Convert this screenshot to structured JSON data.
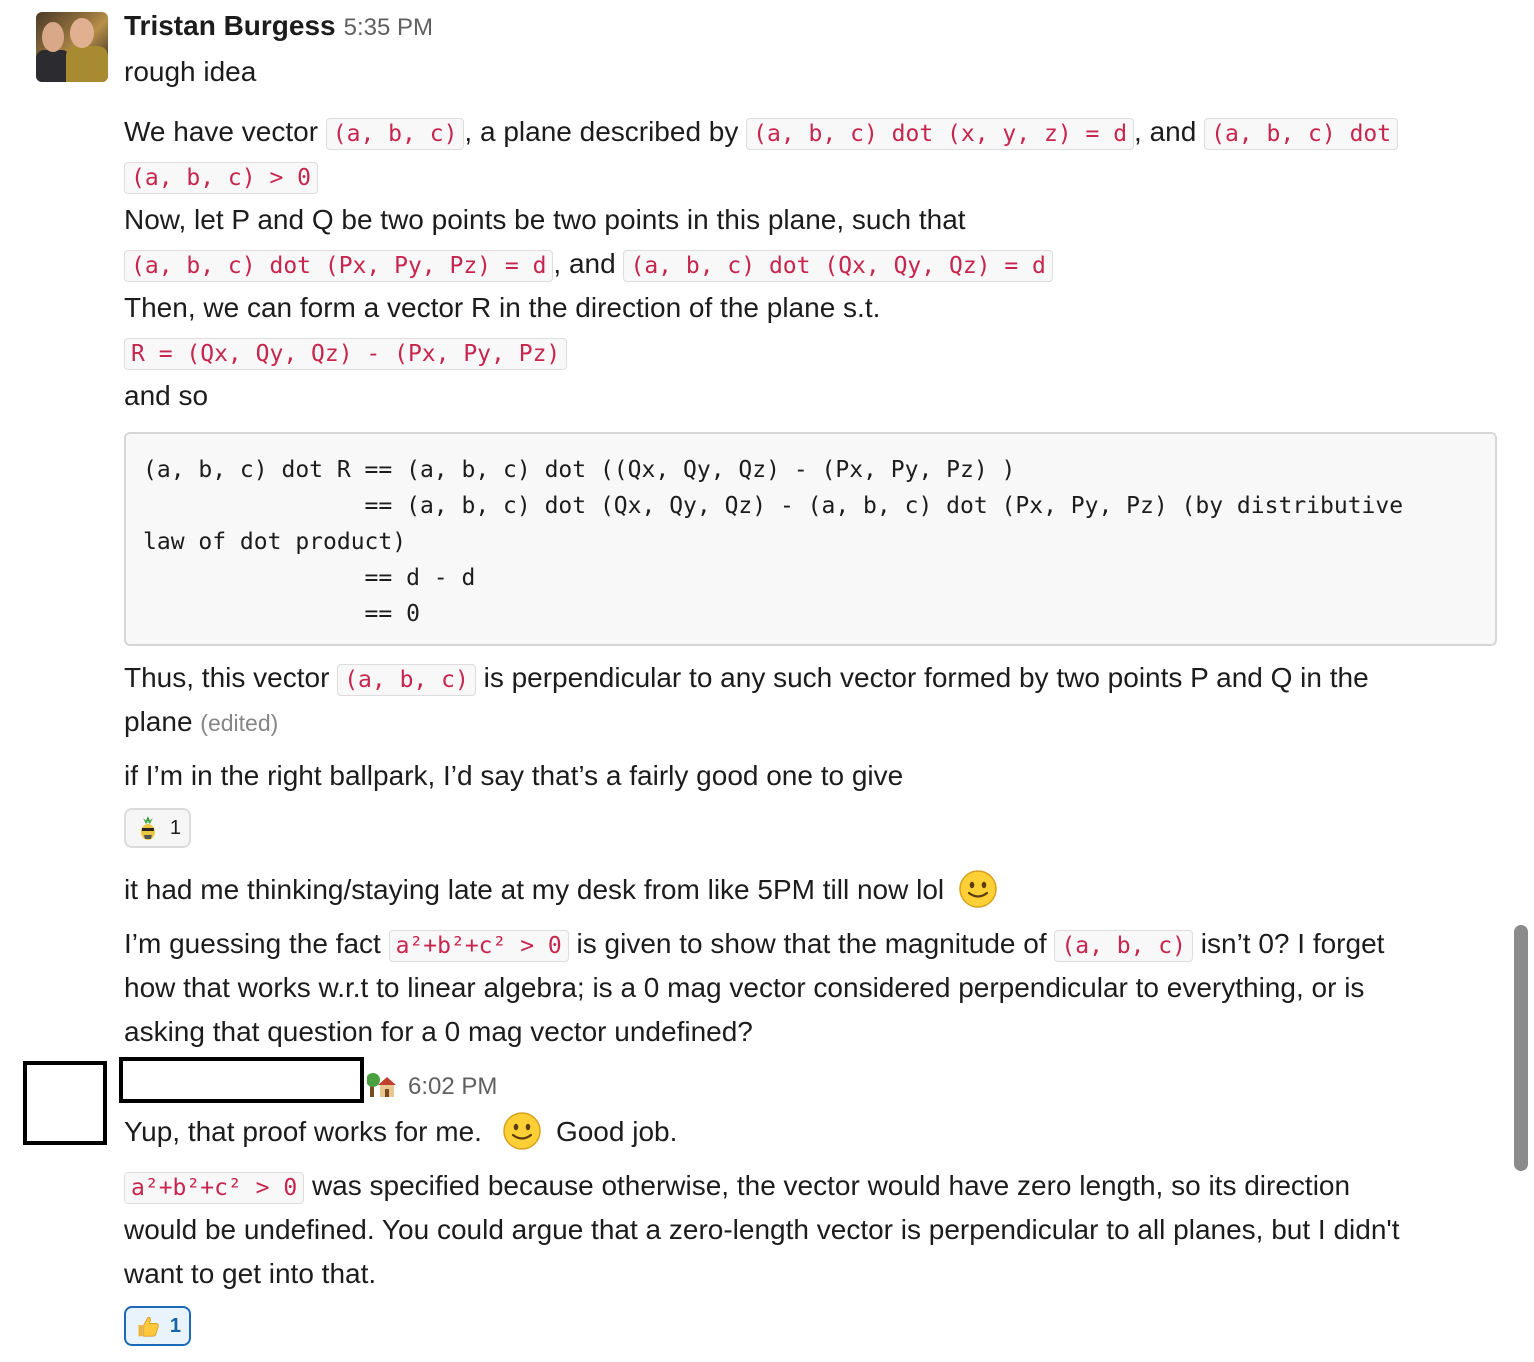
{
  "message1": {
    "author": "Tristan Burgess",
    "time": "5:35 PM",
    "line1": "rough idea",
    "p1": {
      "t1": "We have vector ",
      "c1": "(a, b, c)",
      "t2": ", a plane described by ",
      "c2": "(a, b, c) dot (x, y, z) = d",
      "t3": ", and ",
      "c3a": "(a, b, c) dot",
      "c3b": "(a, b, c) > 0"
    },
    "p2": "Now, let P and Q be two points be two points in this plane, such that",
    "p3": {
      "c1": "(a, b, c) dot (Px, Py, Pz) = d",
      "t1": ", and ",
      "c2": "(a, b, c) dot (Qx, Qy, Qz) = d"
    },
    "p4": "Then, we can form a vector R in the direction of the plane s.t.",
    "p5": "R = (Qx, Qy, Qz) - (Px, Py, Pz)",
    "p6": "and so",
    "code_block": "(a, b, c) dot R == (a, b, c) dot ((Qx, Qy, Qz) - (Px, Py, Pz) )\n                == (a, b, c) dot (Qx, Qy, Qz) - (a, b, c) dot (Px, Py, Pz) (by distributive\nlaw of dot product)\n                == d - d\n                == 0",
    "p7": {
      "t1": "Thus, this vector ",
      "c1": "(a, b, c)",
      "t2": " is perpendicular to any such vector formed by two points P and Q in the",
      "t3": "plane ",
      "edited": "(edited)"
    },
    "p8": "if I’m in the right ballpark, I’d say that’s a fairly good one to give",
    "reaction": {
      "icon": "pineapple-emoji-icon",
      "count": "1"
    },
    "p9": "it had me thinking/staying late at my desk from like 5PM till now lol",
    "p10": {
      "t1": "I’m guessing the fact ",
      "c1": "a²+b²+c² > 0",
      "t2": " is given to show that the magnitude of ",
      "c2": "(a, b, c)",
      "t3": " isn’t 0? I forget",
      "t4": "how that works w.r.t to linear algebra; is a 0 mag vector considered perpendicular to everything, or is",
      "t5": "asking that question for a 0 mag vector undefined?"
    }
  },
  "message2": {
    "time": "6:02 PM",
    "status_icon": "house-with-tree-icon",
    "p1": {
      "t1": "Yup, that proof works for me.",
      "t2": "Good job."
    },
    "p2": {
      "c1": "a²+b²+c² > 0",
      "t1": " was specified because otherwise, the vector would have zero length, so its direction",
      "t2": "would be undefined.  You could argue that a zero-length vector is perpendicular to all planes, but I didn't",
      "t3": "want to get into that."
    },
    "reaction": {
      "icon": "thumbs-up-icon",
      "count": "1"
    }
  },
  "colors": {
    "code_text": "#c7254e",
    "reaction_active_border": "#1d69b8",
    "timestamp": "#616061"
  }
}
